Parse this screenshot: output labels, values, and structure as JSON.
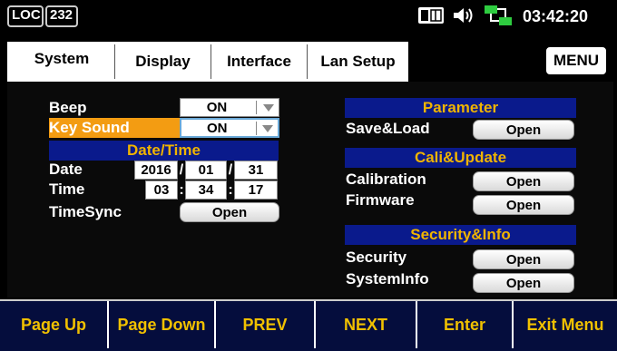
{
  "status": {
    "mode": "LOC",
    "address": "232",
    "clock": "03:42:20"
  },
  "tabs": [
    "System",
    "Display",
    "Interface",
    "Lan Setup"
  ],
  "menu_label": "MENU",
  "left": {
    "beep_label": "Beep",
    "beep_value": "ON",
    "keysound_label": "Key Sound",
    "keysound_value": "ON",
    "datetime_header": "Date/Time",
    "date_label": "Date",
    "date": {
      "year": "2016",
      "month": "01",
      "day": "31"
    },
    "time_label": "Time",
    "time": {
      "hour": "03",
      "minute": "34",
      "second": "17"
    },
    "timesync_label": "TimeSync",
    "timesync_btn": "Open"
  },
  "right": {
    "parameter_header": "Parameter",
    "saveload_label": "Save&Load",
    "saveload_btn": "Open",
    "cali_header": "Cali&Update",
    "calibration_label": "Calibration",
    "calibration_btn": "Open",
    "firmware_label": "Firmware",
    "firmware_btn": "Open",
    "security_header": "Security&Info",
    "security_label": "Security",
    "security_btn": "Open",
    "sysinfo_label": "SystemInfo",
    "sysinfo_btn": "Open"
  },
  "softkeys": [
    "Page Up",
    "Page Down",
    "PREV",
    "NEXT",
    "Enter",
    "Exit Menu"
  ],
  "colors": {
    "header_bg": "#0a1a8c",
    "header_text": "#f0b400",
    "highlight": "#f39c12",
    "softkey_text": "#f0c000"
  }
}
